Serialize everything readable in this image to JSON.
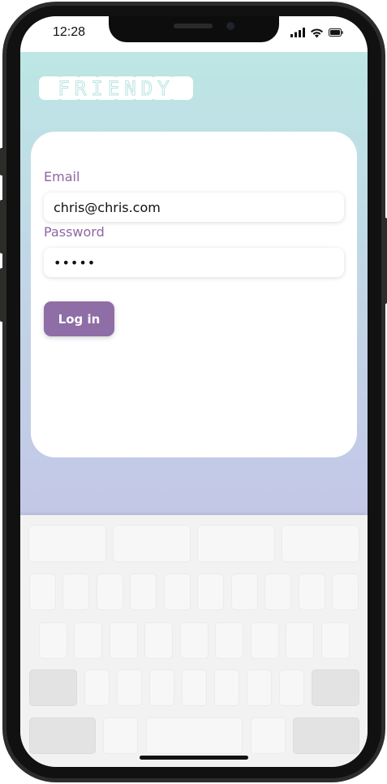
{
  "status_bar": {
    "time": "12:28"
  },
  "app": {
    "logo_text": "FRIENDY",
    "logo_letters": [
      "F",
      "R",
      "I",
      "E",
      "N",
      "D",
      "Y"
    ]
  },
  "login_form": {
    "email_label": "Email",
    "email_value": "chris@chris.com",
    "password_label": "Password",
    "password_value": "•••••",
    "login_button_label": "Log in"
  },
  "colors": {
    "accent": "#8f6da6",
    "label": "#8b67a3",
    "gradient_top": "#bce9e4",
    "gradient_bottom": "#c4c6e8"
  },
  "icons": [
    "signal-icon",
    "wifi-icon",
    "battery-icon"
  ]
}
